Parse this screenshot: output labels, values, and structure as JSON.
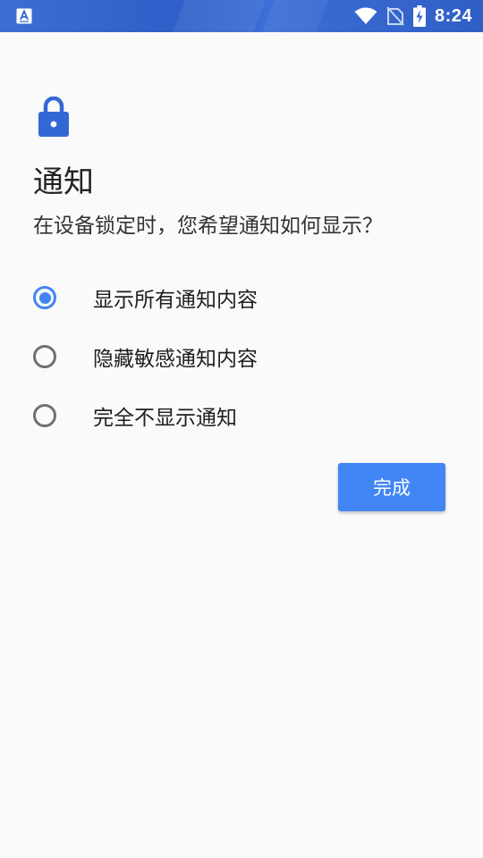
{
  "status_bar": {
    "time": "8:24",
    "background": "#3164cc",
    "icons": [
      "app-notification-icon",
      "wifi-icon",
      "no-sim-icon",
      "battery-charging-icon"
    ]
  },
  "header": {
    "icon": "lock-icon",
    "title": "通知",
    "subtitle": "在设备锁定时，您希望通知如何显示？"
  },
  "options": [
    {
      "label": "显示所有通知内容",
      "selected": true
    },
    {
      "label": "隐藏敏感通知内容",
      "selected": false
    },
    {
      "label": "完全不显示通知",
      "selected": false
    }
  ],
  "actions": {
    "done_label": "完成"
  },
  "colors": {
    "accent": "#4285f4",
    "lock_icon": "#3367d6",
    "background": "#fafafa"
  }
}
